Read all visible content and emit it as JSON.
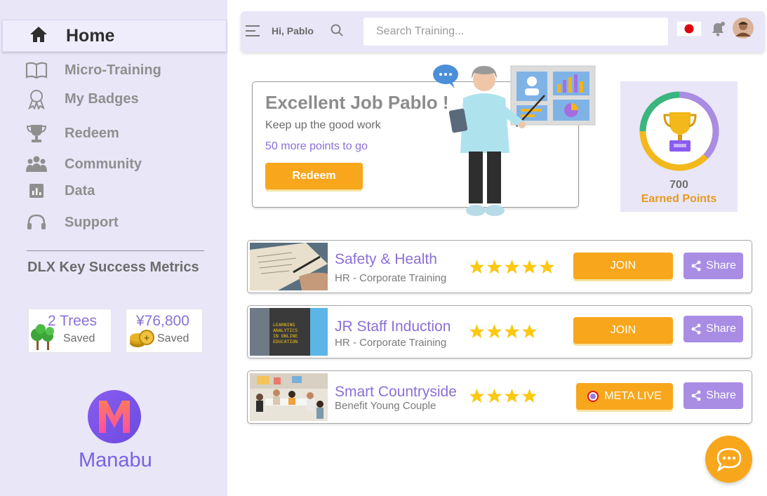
{
  "sidebar": {
    "home_label": "Home",
    "items": [
      {
        "label": "Micro-Training",
        "icon": "book-icon"
      },
      {
        "label": "My Badges",
        "icon": "badge-icon"
      },
      {
        "label": "Redeem",
        "icon": "trophy-icon"
      },
      {
        "label": "Community",
        "icon": "people-icon"
      },
      {
        "label": "Data",
        "icon": "chart-icon"
      },
      {
        "label": "Support",
        "icon": "headset-icon"
      }
    ],
    "metrics_title": "DLX Key Success Metrics",
    "metrics": [
      {
        "value": "2 Trees",
        "label": "Saved",
        "icon": "trees-icon"
      },
      {
        "value": "¥76,800",
        "label": "Saved",
        "icon": "coins-icon"
      }
    ],
    "brand": "Manabu"
  },
  "topbar": {
    "greeting": "Hi, Pablo",
    "search_placeholder": "Search Training..."
  },
  "hero": {
    "title": "Excellent Job Pablo !",
    "subtitle": "Keep up the good work",
    "points_to_go": "50 more points to go",
    "redeem_label": "Redeem"
  },
  "points": {
    "value": "700",
    "label": "Earned Points",
    "progress_fraction": 0.9
  },
  "courses": [
    {
      "title": "Safety & Health",
      "subtitle": "HR - Corporate Training",
      "rating": 5,
      "action": "JOIN",
      "share": "Share"
    },
    {
      "title": "JR Staff Induction",
      "subtitle": "HR - Corporate Training",
      "rating": 4,
      "action": "JOIN",
      "share": "Share"
    },
    {
      "title": "Smart Countryside",
      "subtitle": "Benefit Young Couple",
      "rating": 4,
      "action": "META LIVE",
      "share": "Share"
    }
  ],
  "thumb_book": {
    "line1": "LEARNING",
    "line2": "ANALYTICS",
    "line3": "IN ONLINE",
    "line4": "EDUCATION"
  },
  "colors": {
    "accent_purple": "#8b6fd6",
    "accent_orange": "#f8a61b",
    "sidebar_bg": "#e9e6f8",
    "share_purple": "#a98ce4"
  }
}
